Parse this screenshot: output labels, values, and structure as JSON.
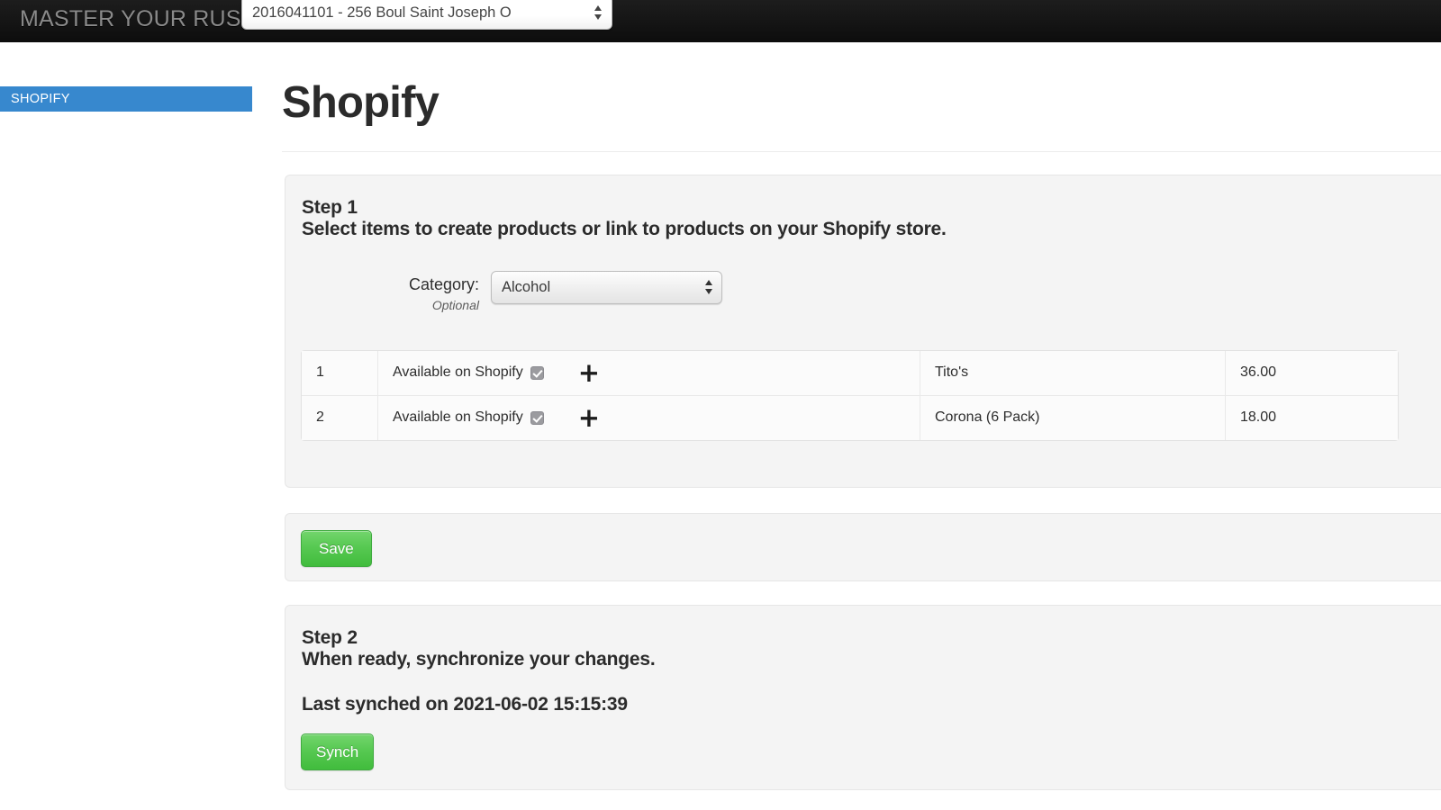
{
  "topbar": {
    "brand": "MASTER YOUR RUSH ::",
    "store_select": {
      "selected": "2016041101 - 256 Boul Saint Joseph O",
      "options": [
        "2016041101 - 256 Boul Saint Joseph O"
      ]
    }
  },
  "sidebar": {
    "items": [
      {
        "label": "SHOPIFY",
        "active": true
      }
    ]
  },
  "page": {
    "title": "Shopify"
  },
  "step1": {
    "heading": "Step 1",
    "subheading": "Select items to create products or link to products on your Shopify store.",
    "category": {
      "label": "Category:",
      "optional": "Optional",
      "selected": "Alcohol",
      "options": [
        "Alcohol"
      ]
    },
    "table": {
      "rows": [
        {
          "index": "1",
          "available_label": "Available on Shopify",
          "available_checked": true,
          "add_icon": "+",
          "product": "Tito's",
          "price": "36.00"
        },
        {
          "index": "2",
          "available_label": "Available on Shopify",
          "available_checked": true,
          "add_icon": "+",
          "product": "Corona (6 Pack)",
          "price": "18.00"
        }
      ]
    }
  },
  "save_panel": {
    "save_label": "Save"
  },
  "step2": {
    "heading": "Step 2",
    "subheading": "When ready, synchronize your changes.",
    "last_synched": "Last synched on 2021-06-02 15:15:39",
    "synch_label": "Synch"
  },
  "colors": {
    "topbar_bg": "#141414",
    "sidebar_active": "#3788ce",
    "button_green": "#57c952",
    "panel_bg": "#f4f4f4"
  }
}
